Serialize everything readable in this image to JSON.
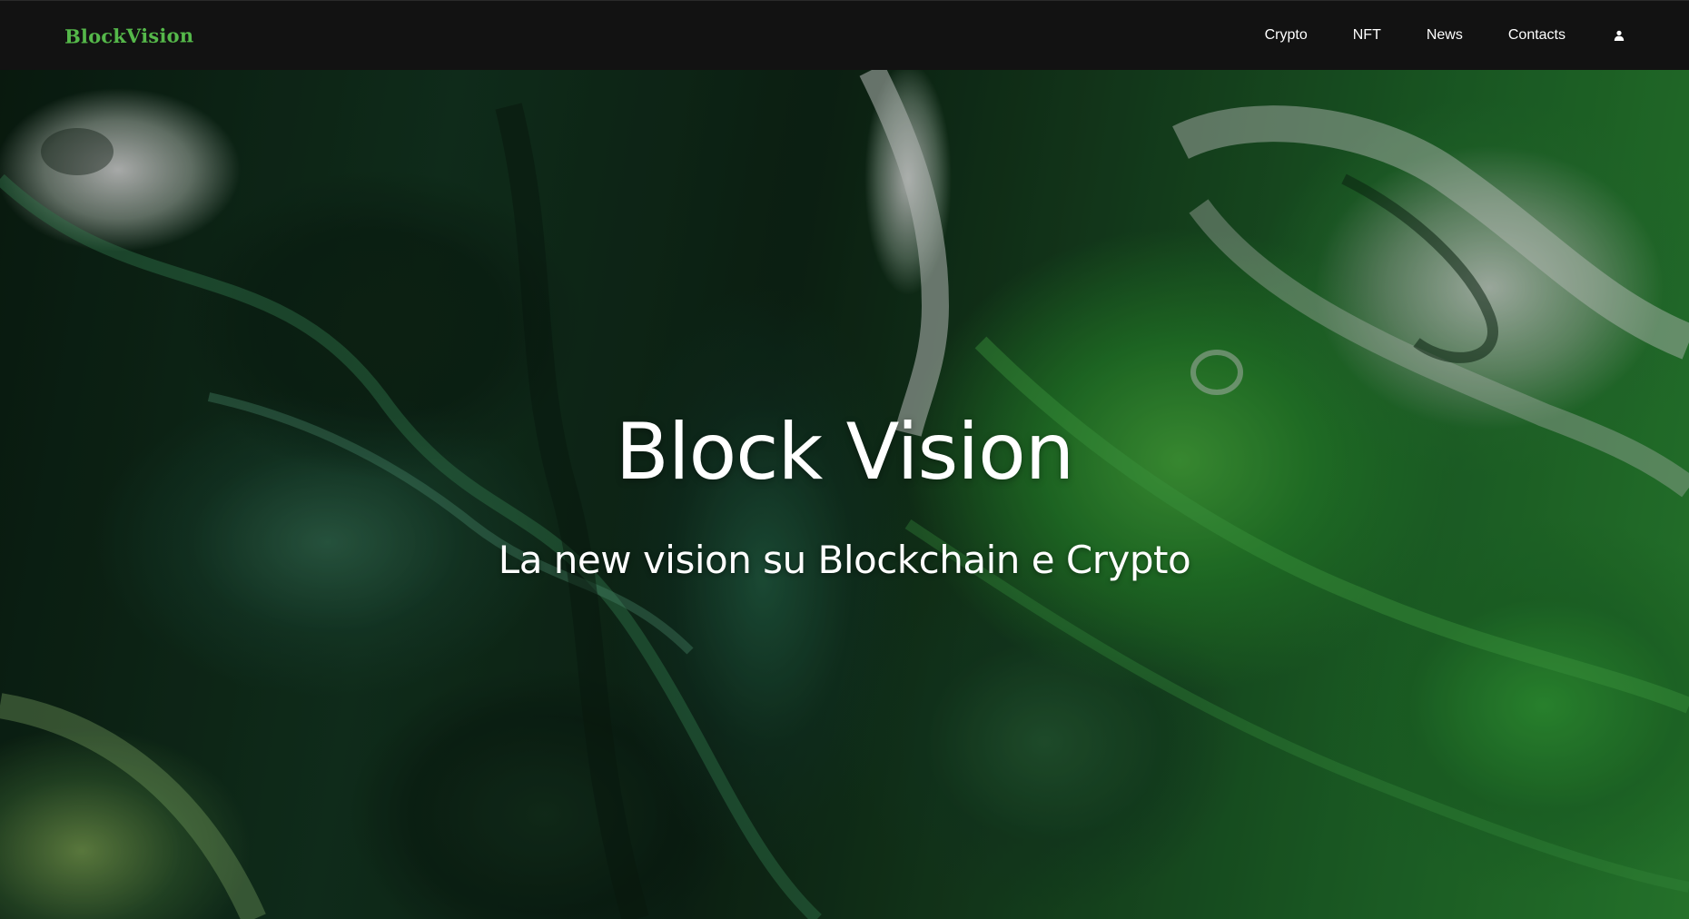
{
  "navbar": {
    "logo": "BlockVision",
    "links": [
      {
        "label": "Crypto"
      },
      {
        "label": "NFT"
      },
      {
        "label": "News"
      },
      {
        "label": "Contacts"
      }
    ],
    "user_icon": "user-icon"
  },
  "hero": {
    "title": "Block Vision",
    "subtitle": "La new vision su Blockchain e Crypto"
  },
  "colors": {
    "navbar_bg": "#121212",
    "logo": "#55b84a",
    "text": "#ffffff",
    "accent_green": "#2c8a33"
  }
}
